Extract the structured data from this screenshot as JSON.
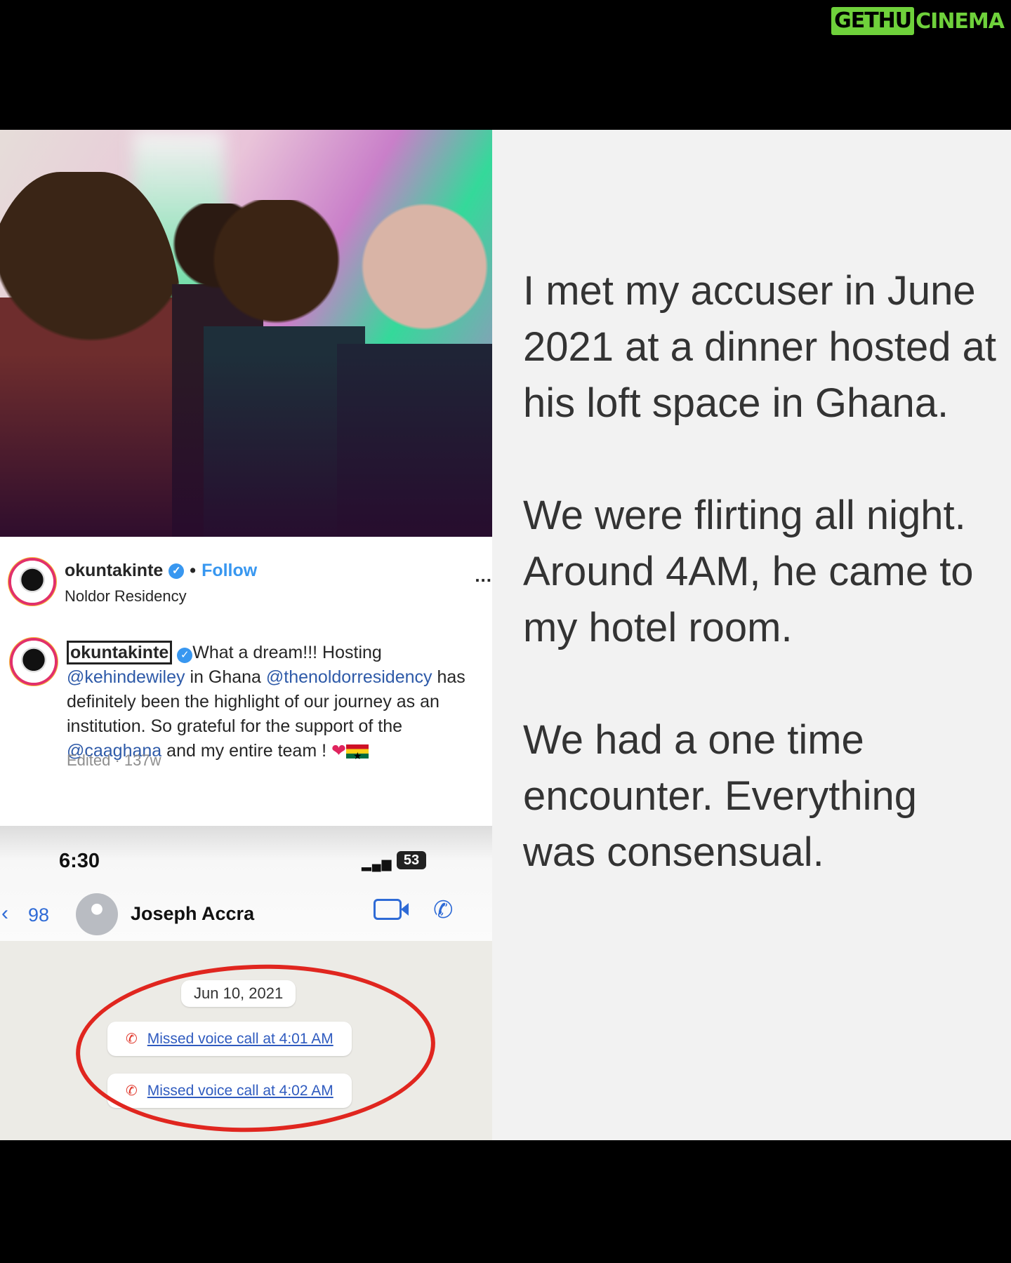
{
  "watermark": {
    "box": "GETHU",
    "tail": "CINEMA"
  },
  "post": {
    "username": "okuntakinte",
    "separator": "•",
    "follow_label": "Follow",
    "location": "Noldor Residency",
    "more_label": "...",
    "caption": {
      "username": "okuntakinte",
      "text_1": "What a dream!!! Hosting ",
      "mention_1": "@kehindewiley",
      "text_2": " in Ghana ",
      "mention_2": "@thenoldorresidency",
      "text_3": " has definitely been the highlight of our journey as an institution. So grateful for the support of the ",
      "mention_3": "@caaghana",
      "text_4": " and my entire team ! "
    },
    "edited": "Edited · 137w"
  },
  "chat": {
    "time": "6:30",
    "battery": "53",
    "back_count": "98",
    "contact": "Joseph Accra",
    "date": "Jun 10, 2021",
    "calls": [
      "Missed voice call at 4:01 AM",
      "Missed voice call at 4:02 AM"
    ]
  },
  "statement": [
    "I met my accuser in June 2021 at a dinner hosted at his loft space in Ghana.",
    "We were flirting all night. Around 4AM, he came to my hotel room.",
    "We had a one time encounter. Everything was consensual."
  ]
}
